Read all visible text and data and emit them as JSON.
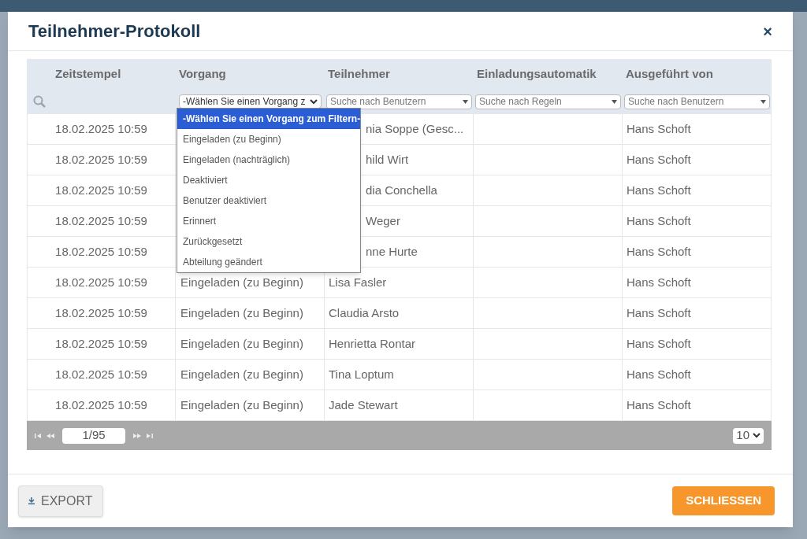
{
  "dialog": {
    "title": "Teilnehmer-Protokoll",
    "close_icon": "×"
  },
  "table": {
    "columns": [
      "Zeitstempel",
      "Vorgang",
      "Teilnehmer",
      "Einladungsautomatik",
      "Ausgeführt von"
    ],
    "filters": [
      {
        "kind": "search"
      },
      {
        "kind": "select",
        "value": "-Wählen Sie einen Vorgang z"
      },
      {
        "kind": "combo",
        "placeholder": "Suche nach Benutzern"
      },
      {
        "kind": "combo",
        "placeholder": "Suche nach Regeln"
      },
      {
        "kind": "combo",
        "placeholder": "Suche nach Benutzern"
      }
    ],
    "rows": [
      {
        "zeitstempel": "18.02.2025 10:59",
        "teilnehmer": "nia Soppe (Gesc...",
        "ausgefuehrt_von": "Hans Schoft"
      },
      {
        "zeitstempel": "18.02.2025 10:59",
        "teilnehmer": "hild Wirt",
        "ausgefuehrt_von": "Hans Schoft"
      },
      {
        "zeitstempel": "18.02.2025 10:59",
        "teilnehmer": "dia Conchella",
        "ausgefuehrt_von": "Hans Schoft"
      },
      {
        "zeitstempel": "18.02.2025 10:59",
        "teilnehmer": "Weger",
        "ausgefuehrt_von": "Hans Schoft"
      },
      {
        "zeitstempel": "18.02.2025 10:59",
        "teilnehmer": "nne Hurte",
        "ausgefuehrt_von": "Hans Schoft"
      },
      {
        "zeitstempel": "18.02.2025 10:59",
        "vorgang": "Eingeladen (zu Beginn)",
        "teilnehmer": "Lisa Fasler",
        "ausgefuehrt_von": "Hans Schoft"
      },
      {
        "zeitstempel": "18.02.2025 10:59",
        "vorgang": "Eingeladen (zu Beginn)",
        "teilnehmer": "Claudia Arsto",
        "ausgefuehrt_von": "Hans Schoft"
      },
      {
        "zeitstempel": "18.02.2025 10:59",
        "vorgang": "Eingeladen (zu Beginn)",
        "teilnehmer": "Henrietta Rontar",
        "ausgefuehrt_von": "Hans Schoft"
      },
      {
        "zeitstempel": "18.02.2025 10:59",
        "vorgang": "Eingeladen (zu Beginn)",
        "teilnehmer": "Tina Loptum",
        "ausgefuehrt_von": "Hans Schoft"
      },
      {
        "zeitstempel": "18.02.2025 10:59",
        "vorgang": "Eingeladen (zu Beginn)",
        "teilnehmer": "Jade Stewart",
        "ausgefuehrt_von": "Hans Schoft"
      }
    ],
    "pager": {
      "page": "1/95",
      "page_size": "10"
    }
  },
  "dropdown": {
    "options": [
      {
        "label": "-Wählen Sie einen Vorgang zum Filtern-",
        "selected": true
      },
      {
        "label": "Eingeladen (zu Beginn)",
        "selected": false
      },
      {
        "label": "Eingeladen (nachträglich)",
        "selected": false
      },
      {
        "label": "Deaktiviert",
        "selected": false
      },
      {
        "label": "Benutzer deaktiviert",
        "selected": false
      },
      {
        "label": "Erinnert",
        "selected": false
      },
      {
        "label": "Zurückgesetzt",
        "selected": false
      },
      {
        "label": "Abteilung geändert",
        "selected": false
      }
    ]
  },
  "footer": {
    "export_label": "EXPORT",
    "close_label": "SCHLIESSEN"
  }
}
